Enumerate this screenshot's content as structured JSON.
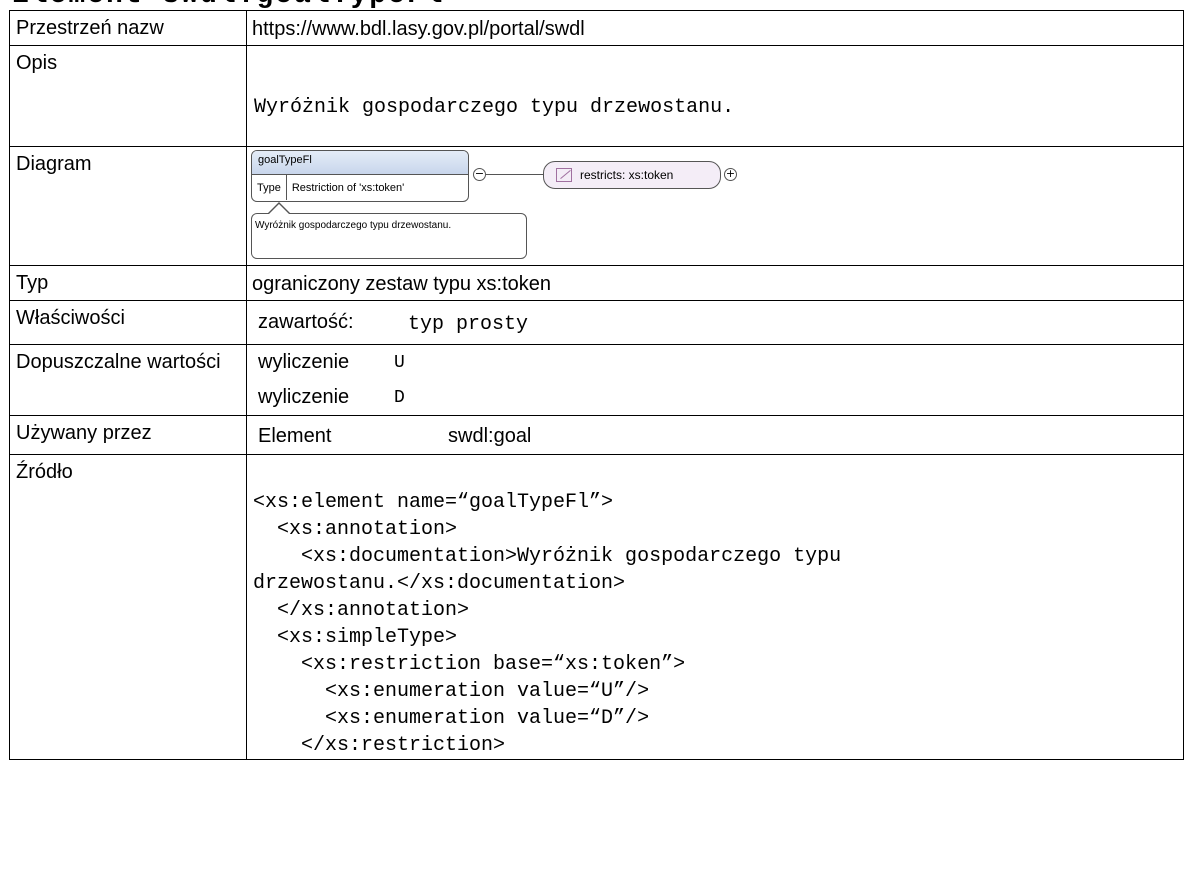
{
  "heading": "Element swdl:goalTypeFl",
  "rows": {
    "namespace": {
      "label": "Przestrzeń nazw",
      "value": "https://www.bdl.lasy.gov.pl/portal/swdl"
    },
    "description": {
      "label": "Opis",
      "value": "Wyróżnik gospodarczego typu drzewostanu."
    },
    "diagram": {
      "label": "Diagram",
      "box_title": "goalTypeFl",
      "box_key": "Type",
      "box_value": "Restriction of 'xs:token'",
      "restriction": "restricts: xs:token",
      "note": "Wyróżnik gospodarczego typu drzewostanu."
    },
    "type": {
      "label": "Typ",
      "value": "ograniczony zestaw typu xs:token"
    },
    "properties": {
      "label": "Właściwości",
      "key": "zawartość:",
      "value": "typ prosty"
    },
    "allowed": {
      "label": "Dopuszczalne wartości",
      "items": [
        {
          "key": "wyliczenie",
          "value": "U"
        },
        {
          "key": "wyliczenie",
          "value": "D"
        }
      ]
    },
    "used_by": {
      "label": "Używany przez",
      "key": "Element",
      "value": "swdl:goal"
    },
    "source": {
      "label": "Źródło",
      "code": "<xs:element name=“goalTypeFl”>\n  <xs:annotation>\n    <xs:documentation>Wyróżnik gospodarczego typu\ndrzewostanu.</xs:documentation>\n  </xs:annotation>\n  <xs:simpleType>\n    <xs:restriction base=“xs:token”>\n      <xs:enumeration value=“U”/>\n      <xs:enumeration value=“D”/>\n    </xs:restriction>"
    }
  },
  "icons": {
    "collapse": "minus-circle-icon",
    "expand": "plus-circle-icon",
    "facet": "restriction-icon"
  }
}
